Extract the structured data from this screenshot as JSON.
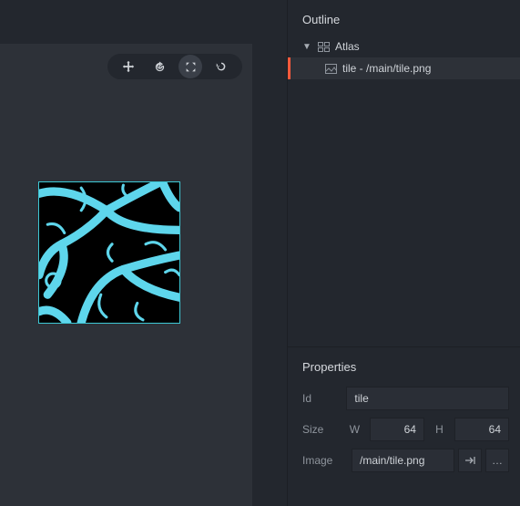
{
  "outline": {
    "title": "Outline",
    "root": {
      "label": "Atlas"
    },
    "selected_item": {
      "label": "tile - /main/tile.png"
    }
  },
  "properties": {
    "title": "Properties",
    "id_label": "Id",
    "id_value": "tile",
    "id_placeholder": "tile",
    "size_label": "Size",
    "width_label": "W",
    "width_value": "64",
    "height_label": "H",
    "height_value": "64",
    "image_label": "Image",
    "image_value": "/main/tile.png"
  },
  "colors": {
    "accent_outline": "#3ec9d6",
    "selection_marker": "#ff5a3c"
  }
}
